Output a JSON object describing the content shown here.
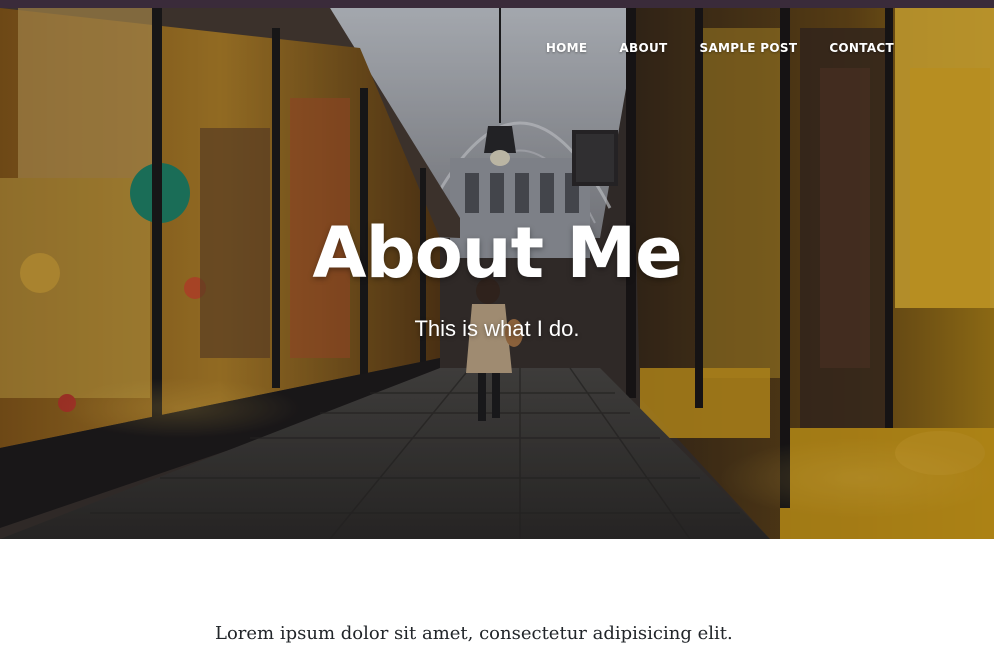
{
  "nav": {
    "items": [
      {
        "label": "HOME"
      },
      {
        "label": "ABOUT"
      },
      {
        "label": "SAMPLE POST"
      },
      {
        "label": "CONTACT"
      }
    ]
  },
  "hero": {
    "heading": "About Me",
    "subheading": "This is what I do."
  },
  "content": {
    "paragraph": "Lorem ipsum dolor sit amet, consectetur adipisicing elit."
  }
}
